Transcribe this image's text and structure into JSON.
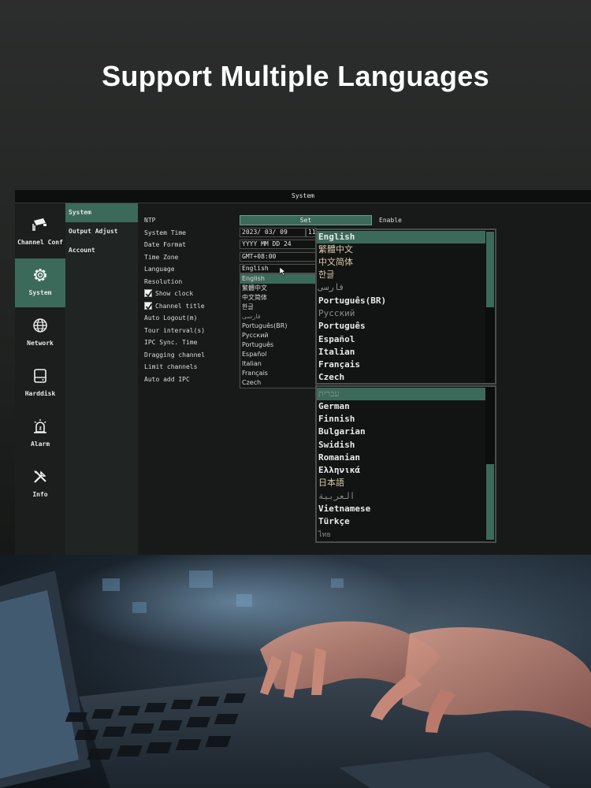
{
  "headline": "Support Multiple Languages",
  "window": {
    "title": "System"
  },
  "nav": [
    {
      "label": "Channel Conf",
      "icon": "camera-icon"
    },
    {
      "label": "System",
      "icon": "gear-icon",
      "active": true
    },
    {
      "label": "Network",
      "icon": "globe-icon"
    },
    {
      "label": "Harddisk",
      "icon": "harddisk-icon"
    },
    {
      "label": "Alarm",
      "icon": "alarm-icon"
    },
    {
      "label": "Info",
      "icon": "tools-icon"
    }
  ],
  "subnav": [
    {
      "label": "System",
      "active": true
    },
    {
      "label": "Output Adjust"
    },
    {
      "label": "Account"
    }
  ],
  "settings": {
    "ntp": {
      "label": "NTP",
      "button": "Set",
      "status": "Enable"
    },
    "system_time": {
      "label": "System Time",
      "date": "2023/ 03/ 09",
      "time": "11"
    },
    "date_format": {
      "label": "Date Format",
      "value": "YYYY MM DD 24"
    },
    "time_zone": {
      "label": "Time Zone",
      "value": "GMT+08:00"
    },
    "language": {
      "label": "Language",
      "value": "English"
    },
    "resolution": {
      "label": "Resolution"
    },
    "show_clock": {
      "label": "Show clock",
      "checked": true
    },
    "channel_title": {
      "label": "Channel title",
      "checked": true
    },
    "auto_logout": {
      "label": "Auto Logout(m)"
    },
    "tour_interval": {
      "label": "Tour interval(s)"
    },
    "ipc_sync": {
      "label": "IPC Sync. Time"
    },
    "dragging_channel": {
      "label": "Dragging channel"
    },
    "limit_channels": {
      "label": "Limit channels"
    },
    "auto_add_ipc": {
      "label": "Auto add IPC"
    }
  },
  "small_dropdown": [
    "English",
    "繁體中文",
    "中文简体",
    "한글",
    "فارسی",
    "Português(BR)",
    "Русский",
    "Português",
    "Español",
    "Italian",
    "Français",
    "Czech"
  ],
  "language_list_1": [
    "English",
    "繁體中文",
    "中文简体",
    "한글",
    "فارسی",
    "Português(BR)",
    "Русский",
    "Português",
    "Español",
    "Italian",
    "Français",
    "Czech"
  ],
  "language_list_2": [
    "עברית",
    "German",
    "Finnish",
    "Bulgarian",
    "Swidish",
    "Romanian",
    "Ελληνικά",
    "日本語",
    "العربية",
    "Vietnamese",
    "Türkçe",
    "ไทย"
  ]
}
